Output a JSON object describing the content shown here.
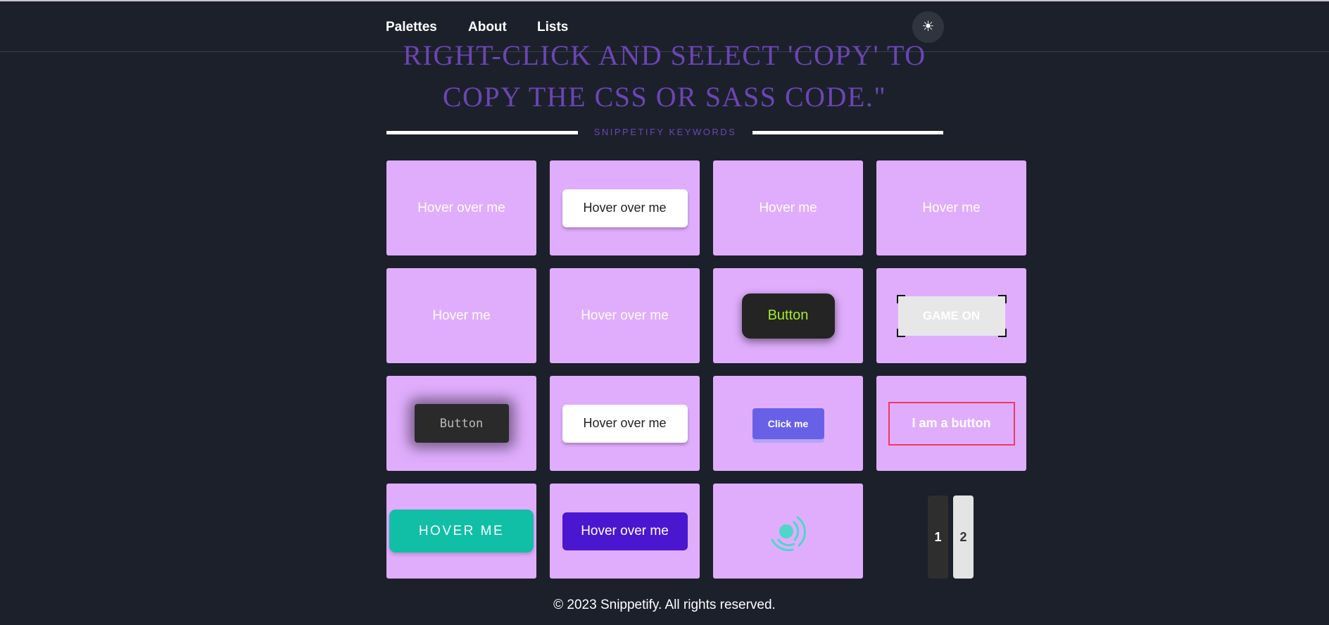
{
  "nav": {
    "links": [
      "Palettes",
      "About",
      "Lists"
    ],
    "theme_icon": "sun-icon",
    "theme_glyph": "☀"
  },
  "hero": {
    "quote": "Right-click and select 'copy' to copy the CSS or Sass code.\"",
    "keywords_label": "SNIPPETIFY KEYWORDS"
  },
  "cards": {
    "c1": "Hover over me",
    "c2": "Hover over me",
    "c3": "Hover me",
    "c4": "Hover me",
    "c5": "Hover me",
    "c6": "Hover over me",
    "c7": "Button",
    "c8": "GAME ON",
    "c9": "Button",
    "c10": "Hover over me",
    "c11": "Click me",
    "c12": "I am a button",
    "c13": "HOVER ME",
    "c14": "Hover over me",
    "c15_icon": "radar-spinner-icon"
  },
  "pagination": {
    "pages": [
      "1",
      "2"
    ],
    "current": "1"
  },
  "footer": {
    "text": "© 2023 Snippetify. All rights reserved."
  },
  "colors": {
    "background": "#1c202b",
    "card": "#e0adfd",
    "accent_text": "#6b45b4",
    "teal": "#10bfa6",
    "purple": "#4a16d0",
    "red_outline": "#ee3b5c",
    "neon_green": "#a6ec27"
  }
}
